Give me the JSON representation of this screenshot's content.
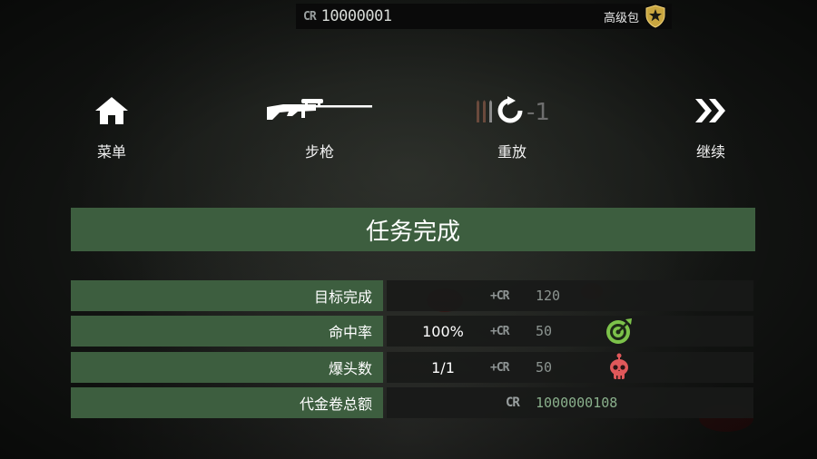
{
  "topbar": {
    "currency_mark": "CR",
    "balance": "10000001",
    "premium_pack_label": "高级包",
    "premium_icon": "shield-star-icon"
  },
  "actions": [
    {
      "id": "menu",
      "label": "菜单",
      "icon": "home-icon"
    },
    {
      "id": "rifle",
      "label": "步枪",
      "icon": "sniper-rifle-icon"
    },
    {
      "id": "replay",
      "label": "重放",
      "icon": "reload-icon",
      "ammo_icon": "bullets-icon",
      "count": "-1"
    },
    {
      "id": "continue",
      "label": "继续",
      "icon": "double-chevron-right-icon"
    }
  ],
  "banner": {
    "title": "任务完成"
  },
  "results": {
    "rows": [
      {
        "label": "目标完成",
        "stat": "",
        "plus_cr": "+CR",
        "reward": "120",
        "icon": ""
      },
      {
        "label": "命中率",
        "stat": "100%",
        "plus_cr": "+CR",
        "reward": "50",
        "icon": "target-icon"
      },
      {
        "label": "爆头数",
        "stat": "1/1",
        "plus_cr": "+CR",
        "reward": "50",
        "icon": "skull-icon"
      }
    ],
    "total": {
      "label": "代金卷总额",
      "currency_mark": "CR",
      "value": "1000000108"
    }
  },
  "colors": {
    "panel_green": "#3d5e3f",
    "target_green": "#7cc24a",
    "skull_red": "#e0585a",
    "total_value": "#8ab08c"
  }
}
